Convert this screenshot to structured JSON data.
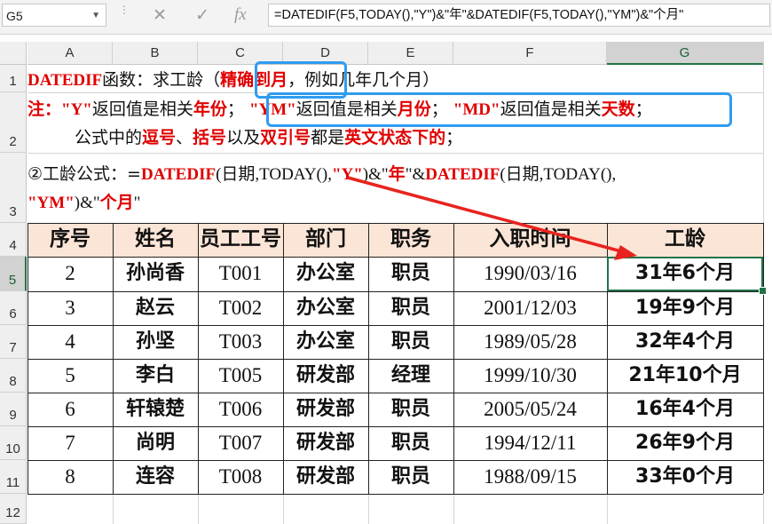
{
  "formula_bar": {
    "name_box": "G5",
    "cancel_icon": "cancel-icon",
    "enter_icon": "checkmark-icon",
    "fx_label": "fx",
    "formula": "=DATEDIF(F5,TODAY(),\"Y\")&\"年\"&DATEDIF(F5,TODAY(),\"YM\")&\"个月\""
  },
  "columns": [
    "A",
    "B",
    "C",
    "D",
    "E",
    "F",
    "G"
  ],
  "selected_column": "G",
  "rows": [
    "1",
    "2",
    "3",
    "4",
    "5",
    "6",
    "7",
    "8",
    "9",
    "10",
    "11",
    "12"
  ],
  "selected_row": "5",
  "notes": {
    "line1": {
      "a": "DATEDIF",
      "b": "函数：求工龄（",
      "c": "精确到月",
      "d": "，例如几年几个月）"
    },
    "line2": {
      "a": "注：",
      "b": "\"Y\"",
      "c": "返回值是相关",
      "d": "年份",
      "e": "；",
      "f": "\"YM\"",
      "g": "返回值是相关",
      "h": "月份",
      "i": "；",
      "j": "\"MD\"",
      "k": "返回值是相关",
      "l": "天数",
      "m": "；"
    },
    "line3": {
      "a": "公式中的",
      "b": "逗号",
      "c": "、",
      "d": "括号",
      "e": "以及",
      "f": "双引号",
      "g": "都是",
      "h": "英文状态下的",
      "i": "；"
    },
    "line4": {
      "a": "②工龄公式：=",
      "b": "DATEDIF",
      "c": "(日期,TODAY(),",
      "d": "\"Y\"",
      "e": ")&\"",
      "f": "年",
      "g": "\"&",
      "h": "DATEDIF",
      "i": "(日期,TODAY(),"
    },
    "line5": {
      "a": "\"YM\"",
      "b": ")&\"",
      "c": "个月",
      "d": "\""
    }
  },
  "table": {
    "headers": [
      "序号",
      "姓名",
      "员工工号",
      "部门",
      "职务",
      "入职时间",
      "工龄"
    ],
    "rows": [
      [
        "2",
        "孙尚香",
        "T001",
        "办公室",
        "职员",
        "1990/03/16",
        "31年6个月"
      ],
      [
        "3",
        "赵云",
        "T002",
        "办公室",
        "职员",
        "2001/12/03",
        "19年9个月"
      ],
      [
        "4",
        "孙坚",
        "T003",
        "办公室",
        "职员",
        "1989/05/28",
        "32年4个月"
      ],
      [
        "5",
        "李白",
        "T005",
        "研发部",
        "经理",
        "1999/10/30",
        "21年10个月"
      ],
      [
        "6",
        "轩辕楚",
        "T006",
        "研发部",
        "职员",
        "2005/05/24",
        "16年4个月"
      ],
      [
        "7",
        "尚明",
        "T007",
        "研发部",
        "职员",
        "1994/12/11",
        "26年9个月"
      ],
      [
        "8",
        "连容",
        "T008",
        "研发部",
        "职员",
        "1988/09/15",
        "33年0个月"
      ]
    ]
  },
  "colors": {
    "header_fill": "#fbe5d6",
    "highlight_red": "#e00000",
    "callout_blue": "#2f9cf0",
    "excel_green": "#217346"
  }
}
